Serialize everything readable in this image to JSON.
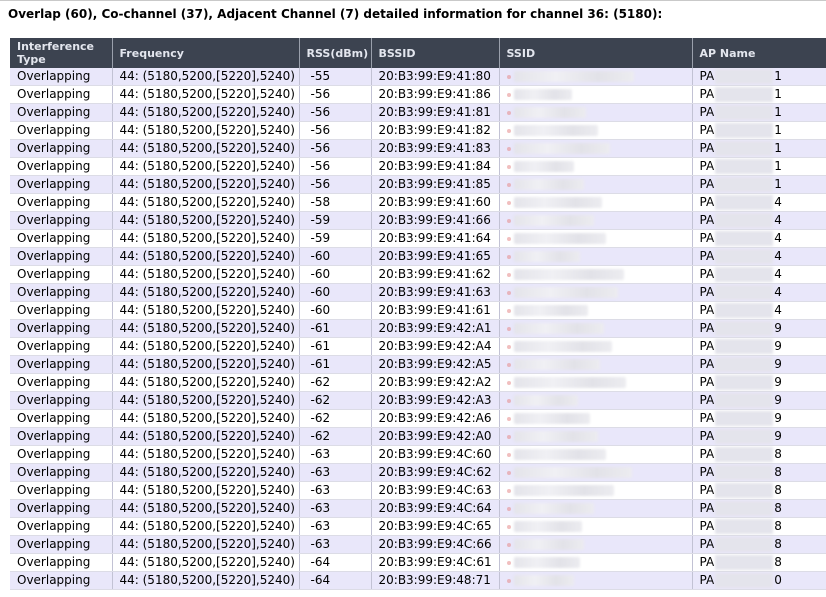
{
  "heading": "Overlap (60), Co-channel (37), Adjacent Channel (7) detailed information for channel 36: (5180):",
  "columns": [
    "Interference Type",
    "Frequency",
    "RSS(dBm)",
    "BSSID",
    "SSID",
    "AP Name"
  ],
  "rows": [
    {
      "type": "Overlapping",
      "freq": "44: (5180,5200,[5220],5240)",
      "rss": "-55",
      "bssid": "20:B3:99:E9:41:80",
      "ap_prefix": "PA",
      "ap_suffix": "1"
    },
    {
      "type": "Overlapping",
      "freq": "44: (5180,5200,[5220],5240)",
      "rss": "-56",
      "bssid": "20:B3:99:E9:41:86",
      "ap_prefix": "PA",
      "ap_suffix": "1"
    },
    {
      "type": "Overlapping",
      "freq": "44: (5180,5200,[5220],5240)",
      "rss": "-56",
      "bssid": "20:B3:99:E9:41:81",
      "ap_prefix": "PA",
      "ap_suffix": "1"
    },
    {
      "type": "Overlapping",
      "freq": "44: (5180,5200,[5220],5240)",
      "rss": "-56",
      "bssid": "20:B3:99:E9:41:82",
      "ap_prefix": "PA",
      "ap_suffix": "1"
    },
    {
      "type": "Overlapping",
      "freq": "44: (5180,5200,[5220],5240)",
      "rss": "-56",
      "bssid": "20:B3:99:E9:41:83",
      "ap_prefix": "PA",
      "ap_suffix": "1"
    },
    {
      "type": "Overlapping",
      "freq": "44: (5180,5200,[5220],5240)",
      "rss": "-56",
      "bssid": "20:B3:99:E9:41:84",
      "ap_prefix": "PA",
      "ap_suffix": "1"
    },
    {
      "type": "Overlapping",
      "freq": "44: (5180,5200,[5220],5240)",
      "rss": "-56",
      "bssid": "20:B3:99:E9:41:85",
      "ap_prefix": "PA",
      "ap_suffix": "1"
    },
    {
      "type": "Overlapping",
      "freq": "44: (5180,5200,[5220],5240)",
      "rss": "-58",
      "bssid": "20:B3:99:E9:41:60",
      "ap_prefix": "PA",
      "ap_suffix": "4"
    },
    {
      "type": "Overlapping",
      "freq": "44: (5180,5200,[5220],5240)",
      "rss": "-59",
      "bssid": "20:B3:99:E9:41:66",
      "ap_prefix": "PA",
      "ap_suffix": "4"
    },
    {
      "type": "Overlapping",
      "freq": "44: (5180,5200,[5220],5240)",
      "rss": "-59",
      "bssid": "20:B3:99:E9:41:64",
      "ap_prefix": "PA",
      "ap_suffix": "4"
    },
    {
      "type": "Overlapping",
      "freq": "44: (5180,5200,[5220],5240)",
      "rss": "-60",
      "bssid": "20:B3:99:E9:41:65",
      "ap_prefix": "PA",
      "ap_suffix": "4"
    },
    {
      "type": "Overlapping",
      "freq": "44: (5180,5200,[5220],5240)",
      "rss": "-60",
      "bssid": "20:B3:99:E9:41:62",
      "ap_prefix": "PA",
      "ap_suffix": "4"
    },
    {
      "type": "Overlapping",
      "freq": "44: (5180,5200,[5220],5240)",
      "rss": "-60",
      "bssid": "20:B3:99:E9:41:63",
      "ap_prefix": "PA",
      "ap_suffix": "4"
    },
    {
      "type": "Overlapping",
      "freq": "44: (5180,5200,[5220],5240)",
      "rss": "-60",
      "bssid": "20:B3:99:E9:41:61",
      "ap_prefix": "PA",
      "ap_suffix": "4"
    },
    {
      "type": "Overlapping",
      "freq": "44: (5180,5200,[5220],5240)",
      "rss": "-61",
      "bssid": "20:B3:99:E9:42:A1",
      "ap_prefix": "PA",
      "ap_suffix": "9"
    },
    {
      "type": "Overlapping",
      "freq": "44: (5180,5200,[5220],5240)",
      "rss": "-61",
      "bssid": "20:B3:99:E9:42:A4",
      "ap_prefix": "PA",
      "ap_suffix": "9"
    },
    {
      "type": "Overlapping",
      "freq": "44: (5180,5200,[5220],5240)",
      "rss": "-61",
      "bssid": "20:B3:99:E9:42:A5",
      "ap_prefix": "PA",
      "ap_suffix": "9"
    },
    {
      "type": "Overlapping",
      "freq": "44: (5180,5200,[5220],5240)",
      "rss": "-62",
      "bssid": "20:B3:99:E9:42:A2",
      "ap_prefix": "PA",
      "ap_suffix": "9"
    },
    {
      "type": "Overlapping",
      "freq": "44: (5180,5200,[5220],5240)",
      "rss": "-62",
      "bssid": "20:B3:99:E9:42:A3",
      "ap_prefix": "PA",
      "ap_suffix": "9"
    },
    {
      "type": "Overlapping",
      "freq": "44: (5180,5200,[5220],5240)",
      "rss": "-62",
      "bssid": "20:B3:99:E9:42:A6",
      "ap_prefix": "PA",
      "ap_suffix": "9"
    },
    {
      "type": "Overlapping",
      "freq": "44: (5180,5200,[5220],5240)",
      "rss": "-62",
      "bssid": "20:B3:99:E9:42:A0",
      "ap_prefix": "PA",
      "ap_suffix": "9"
    },
    {
      "type": "Overlapping",
      "freq": "44: (5180,5200,[5220],5240)",
      "rss": "-63",
      "bssid": "20:B3:99:E9:4C:60",
      "ap_prefix": "PA",
      "ap_suffix": "8"
    },
    {
      "type": "Overlapping",
      "freq": "44: (5180,5200,[5220],5240)",
      "rss": "-63",
      "bssid": "20:B3:99:E9:4C:62",
      "ap_prefix": "PA",
      "ap_suffix": "8"
    },
    {
      "type": "Overlapping",
      "freq": "44: (5180,5200,[5220],5240)",
      "rss": "-63",
      "bssid": "20:B3:99:E9:4C:63",
      "ap_prefix": "PA",
      "ap_suffix": "8"
    },
    {
      "type": "Overlapping",
      "freq": "44: (5180,5200,[5220],5240)",
      "rss": "-63",
      "bssid": "20:B3:99:E9:4C:64",
      "ap_prefix": "PA",
      "ap_suffix": "8"
    },
    {
      "type": "Overlapping",
      "freq": "44: (5180,5200,[5220],5240)",
      "rss": "-63",
      "bssid": "20:B3:99:E9:4C:65",
      "ap_prefix": "PA",
      "ap_suffix": "8"
    },
    {
      "type": "Overlapping",
      "freq": "44: (5180,5200,[5220],5240)",
      "rss": "-63",
      "bssid": "20:B3:99:E9:4C:66",
      "ap_prefix": "PA",
      "ap_suffix": "8"
    },
    {
      "type": "Overlapping",
      "freq": "44: (5180,5200,[5220],5240)",
      "rss": "-64",
      "bssid": "20:B3:99:E9:4C:61",
      "ap_prefix": "PA",
      "ap_suffix": "8"
    },
    {
      "type": "Overlapping",
      "freq": "44: (5180,5200,[5220],5240)",
      "rss": "-64",
      "bssid": "20:B3:99:E9:48:71",
      "ap_prefix": "PA",
      "ap_suffix": "0"
    }
  ],
  "colors": {
    "header_bg": "#3c4350",
    "header_text": "#e3e6ee",
    "row_odd": "#e9e7fa",
    "row_even": "#ffffff"
  }
}
